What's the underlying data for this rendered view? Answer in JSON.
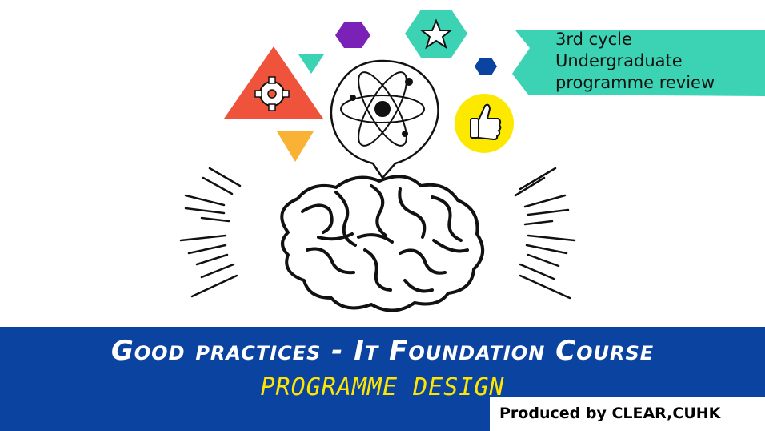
{
  "banner": {
    "text": "3rd cycle\nUndergraduate\nprogramme review"
  },
  "footer": {
    "title": "Good practices - It Foundation Course",
    "subtitle": "PROGRAMME DESIGN",
    "credit": "Produced by CLEAR,CUHK"
  },
  "colors": {
    "band": "#0b43a0",
    "title_text": "#ffffff",
    "subtitle_text": "#ffe600",
    "ribbon": "#3bd3b3",
    "triangle_red": "#f0533b",
    "triangle_orange": "#f9b233",
    "hexagon_purple": "#7a22b7",
    "hexagon_teal": "#3bd3b3",
    "hexagon_blue": "#0b43a0",
    "thumb_circle": "#fde800"
  },
  "icons": [
    "gear-icon",
    "star-icon",
    "atom-icon",
    "thumbs-up-icon",
    "brain-illustration"
  ]
}
